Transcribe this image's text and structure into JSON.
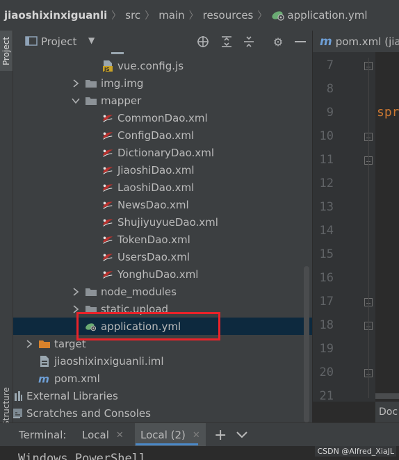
{
  "breadcrumb": [
    "jiaoshixinxiguanli",
    "src",
    "main",
    "resources",
    "application.yml"
  ],
  "left_strip": {
    "project_tab": "Project",
    "structure_tab": "Structure"
  },
  "project_panel": {
    "title": "Project",
    "icons": [
      "locate-icon",
      "expand-all-icon",
      "collapse-all-icon",
      "gear-icon",
      "minimize-icon"
    ]
  },
  "tree": [
    {
      "label": "vue.config.js",
      "icon": "js-file-icon",
      "arrow": "none"
    },
    {
      "label": "img.img",
      "icon": "folder-icon",
      "arrow": "right"
    },
    {
      "label": "mapper",
      "icon": "folder-icon",
      "arrow": "down"
    },
    {
      "label": "CommonDao.xml",
      "icon": "mybatis-icon",
      "arrow": "none"
    },
    {
      "label": "ConfigDao.xml",
      "icon": "mybatis-icon",
      "arrow": "none"
    },
    {
      "label": "DictionaryDao.xml",
      "icon": "mybatis-icon",
      "arrow": "none"
    },
    {
      "label": "JiaoshiDao.xml",
      "icon": "mybatis-icon",
      "arrow": "none"
    },
    {
      "label": "LaoshiDao.xml",
      "icon": "mybatis-icon",
      "arrow": "none"
    },
    {
      "label": "NewsDao.xml",
      "icon": "mybatis-icon",
      "arrow": "none"
    },
    {
      "label": "ShujiyuyueDao.xml",
      "icon": "mybatis-icon",
      "arrow": "none"
    },
    {
      "label": "TokenDao.xml",
      "icon": "mybatis-icon",
      "arrow": "none"
    },
    {
      "label": "UsersDao.xml",
      "icon": "mybatis-icon",
      "arrow": "none"
    },
    {
      "label": "YonghuDao.xml",
      "icon": "mybatis-icon",
      "arrow": "none"
    },
    {
      "label": "node_modules",
      "icon": "folder-icon",
      "arrow": "right"
    },
    {
      "label": "static.upload",
      "icon": "folder-icon",
      "arrow": "right"
    },
    {
      "label": "application.yml",
      "icon": "spring-yml-icon",
      "arrow": "none",
      "selected": true
    },
    {
      "label": "target",
      "icon": "orange-folder-icon",
      "arrow": "right"
    },
    {
      "label": "jiaoshixinxiguanli.iml",
      "icon": "iml-file-icon",
      "arrow": "none"
    },
    {
      "label": "pom.xml",
      "icon": "maven-icon",
      "arrow": "none"
    },
    {
      "label": "External Libraries",
      "icon": "libraries-icon",
      "arrow": "right"
    },
    {
      "label": "Scratches and Consoles",
      "icon": "scratches-icon",
      "arrow": "right"
    }
  ],
  "editor": {
    "tab_label": "pom.xml (jia",
    "line_numbers": [
      "7",
      "8",
      "9",
      "10",
      "11",
      "12",
      "13",
      "14",
      "15",
      "16",
      "17",
      "18",
      "19",
      "20",
      "21"
    ],
    "code_fragment": "spr",
    "bottom_tab": "Doc"
  },
  "terminal": {
    "label": "Terminal:",
    "tabs": [
      "Local",
      "Local (2)"
    ],
    "add": "+",
    "menu": "⌄",
    "body_text": "Windows PowerShell"
  },
  "watermark": "CSDN @Alfred_XiaJL",
  "colors": {
    "selection": "#0d293e",
    "highlight_box": "#e8232a",
    "keyword": "#cc7832"
  }
}
